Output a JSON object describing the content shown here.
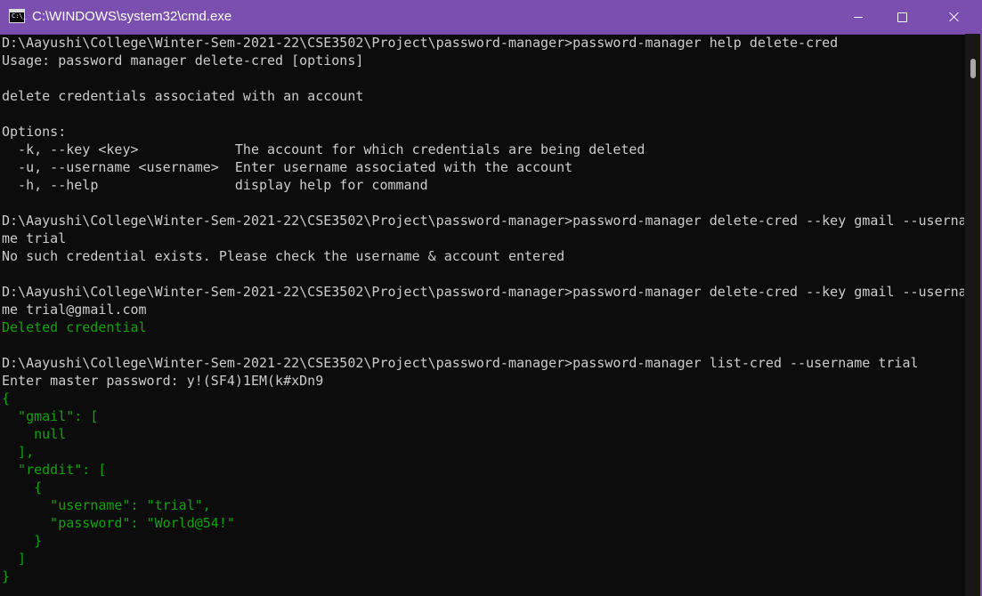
{
  "window": {
    "title": "C:\\WINDOWS\\system32\\cmd.exe",
    "icon_label": "C:\\_",
    "title_bar_color": "#7b4fb0"
  },
  "colors": {
    "text": "#cccccc",
    "success": "#13a10e",
    "background": "#0c0c0c"
  },
  "console": {
    "lines": [
      {
        "text": "D:\\Aayushi\\College\\Winter-Sem-2021-22\\CSE3502\\Project\\password-manager>password-manager help delete-cred",
        "color": "gray"
      },
      {
        "text": "Usage: password manager delete-cred [options]",
        "color": "gray"
      },
      {
        "text": "",
        "color": "gray"
      },
      {
        "text": "delete credentials associated with an account",
        "color": "gray"
      },
      {
        "text": "",
        "color": "gray"
      },
      {
        "text": "Options:",
        "color": "gray"
      },
      {
        "text": "  -k, --key <key>            The account for which credentials are being deleted",
        "color": "gray"
      },
      {
        "text": "  -u, --username <username>  Enter username associated with the account",
        "color": "gray"
      },
      {
        "text": "  -h, --help                 display help for command",
        "color": "gray"
      },
      {
        "text": "",
        "color": "gray"
      },
      {
        "text": "D:\\Aayushi\\College\\Winter-Sem-2021-22\\CSE3502\\Project\\password-manager>password-manager delete-cred --key gmail --userna",
        "color": "gray"
      },
      {
        "text": "me trial",
        "color": "gray"
      },
      {
        "text": "No such credential exists. Please check the username & account entered",
        "color": "gray"
      },
      {
        "text": "",
        "color": "gray"
      },
      {
        "text": "D:\\Aayushi\\College\\Winter-Sem-2021-22\\CSE3502\\Project\\password-manager>password-manager delete-cred --key gmail --userna",
        "color": "gray"
      },
      {
        "text": "me trial@gmail.com",
        "color": "gray"
      },
      {
        "text": "Deleted credential",
        "color": "green"
      },
      {
        "text": "",
        "color": "gray"
      },
      {
        "text": "D:\\Aayushi\\College\\Winter-Sem-2021-22\\CSE3502\\Project\\password-manager>password-manager list-cred --username trial",
        "color": "gray"
      },
      {
        "text": "Enter master password: y!(SF4)1EM(k#xDn9",
        "color": "gray"
      },
      {
        "text": "{",
        "color": "green"
      },
      {
        "text": "  \"gmail\": [",
        "color": "green"
      },
      {
        "text": "    null",
        "color": "green"
      },
      {
        "text": "  ],",
        "color": "green"
      },
      {
        "text": "  \"reddit\": [",
        "color": "green"
      },
      {
        "text": "    {",
        "color": "green"
      },
      {
        "text": "      \"username\": \"trial\",",
        "color": "green"
      },
      {
        "text": "      \"password\": \"World@54!\"",
        "color": "green"
      },
      {
        "text": "    }",
        "color": "green"
      },
      {
        "text": "  ]",
        "color": "green"
      },
      {
        "text": "}",
        "color": "green"
      }
    ]
  }
}
